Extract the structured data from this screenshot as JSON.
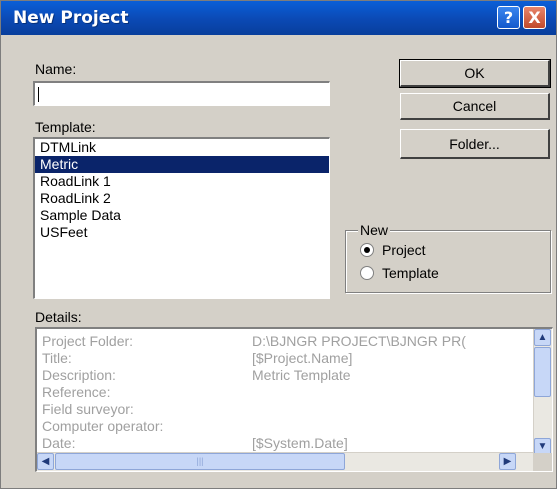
{
  "window": {
    "title": "New Project",
    "help_glyph": "?",
    "close_glyph": "X"
  },
  "name_field": {
    "label": "Name:",
    "value": ""
  },
  "buttons": {
    "ok": "OK",
    "cancel": "Cancel",
    "folder": "Folder..."
  },
  "template": {
    "label": "Template:",
    "items": [
      "DTMLink",
      "Metric",
      "RoadLink 1",
      "RoadLink 2",
      "Sample Data",
      "USFeet"
    ],
    "selected": "Metric"
  },
  "new_group": {
    "legend": "New",
    "options": [
      {
        "label": "Project",
        "checked": true
      },
      {
        "label": "Template",
        "checked": false
      }
    ]
  },
  "details": {
    "label": "Details:",
    "rows": [
      {
        "key": "Project Folder:",
        "value": "D:\\BJNGR PROJECT\\BJNGR PR("
      },
      {
        "key": "Title:",
        "value": "[$Project.Name]"
      },
      {
        "key": "Description:",
        "value": "Metric Template"
      },
      {
        "key": "Reference:",
        "value": ""
      },
      {
        "key": "Field surveyor:",
        "value": ""
      },
      {
        "key": "Computer operator:",
        "value": ""
      },
      {
        "key": "Date:",
        "value": "[$System.Date]"
      }
    ]
  },
  "scroll_glyphs": {
    "up": "▲",
    "down": "▼",
    "left": "◀",
    "right": "▶",
    "grip": "|||"
  }
}
